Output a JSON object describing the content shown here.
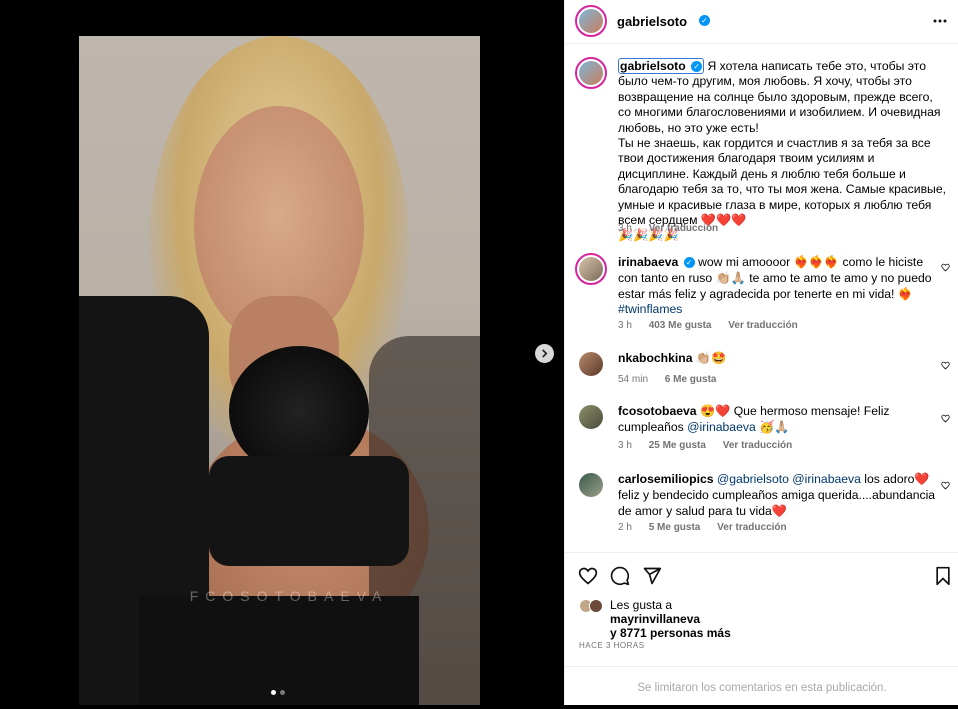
{
  "post": {
    "author": "gabrielsoto",
    "watermark": "FCOSOTOBAEVA",
    "caption_author": "gabrielsoto",
    "caption_text": "Я хотела написать тебе это, чтобы это было чем-то другим, моя любовь. Я хочу, чтобы это возвращение на солнце было здоровым, прежде всего, со многими благословениями и изобилием. И очевидная любовь, но это уже есть!\nТы не знаешь, как гордится и счастлив я за тебя за все твои достижения благодаря твоим усилиям и дисциплине. Каждый день я люблю тебя больше и благодарю тебя за то, что ты моя жена. Самые красивые, умные и красивые глаза в мире, которых я люблю тебя всем сердцем ❤️❤️❤️\n🎉🎉🎉🎉",
    "caption_time": "3 h",
    "translate_label": "Ver traducción",
    "carousel": {
      "current": 1,
      "total": 2
    }
  },
  "comments": [
    {
      "user": "irinabaeva",
      "verified": true,
      "text_before": "wow mi amoooor ❤️‍🔥❤️‍🔥❤️‍🔥 como le hiciste con tanto en ruso 👏🏼🙏🏼 te amo te amo te amo y no puedo estar más feliz y agradecida por tenerte en mi vida! ❤️‍🔥",
      "hashtag": "#twinflames",
      "time": "3 h",
      "likes": "403 Me gusta",
      "translate": "Ver traducción"
    },
    {
      "user": "nkabochkina",
      "text": "👏🏼🤩",
      "time": "54 min",
      "likes": "6 Me gusta"
    },
    {
      "user": "fcosotobaeva",
      "text_before": "😍❤️ Que hermoso mensaje! Feliz cumpleaños ",
      "mention": "@irinabaeva",
      "text_after": " 🥳🙏🏼",
      "time": "3 h",
      "likes": "25 Me gusta",
      "translate": "Ver traducción"
    },
    {
      "user": "carlosemiliopics",
      "mention1": "@gabrielsoto",
      "mention2": "@irinabaeva",
      "text_after": " los adoro❤️ feliz y bendecido cumpleaños amiga querida....abundancia de amor y salud para tu vida❤️",
      "time": "2 h",
      "likes": "5 Me gusta",
      "translate": "Ver traducción"
    }
  ],
  "likes": {
    "prefix": "Les gusta a",
    "user": "mayrinvillaneva",
    "others": "y 8771 personas más"
  },
  "time_ago": "HACE 3 HORAS",
  "comments_limited": "Se limitaron los comentarios en esta publicación.",
  "colors": {
    "accent": "#0095f6",
    "link": "#00376b",
    "muted": "#737373",
    "ring": "#d6249f"
  }
}
